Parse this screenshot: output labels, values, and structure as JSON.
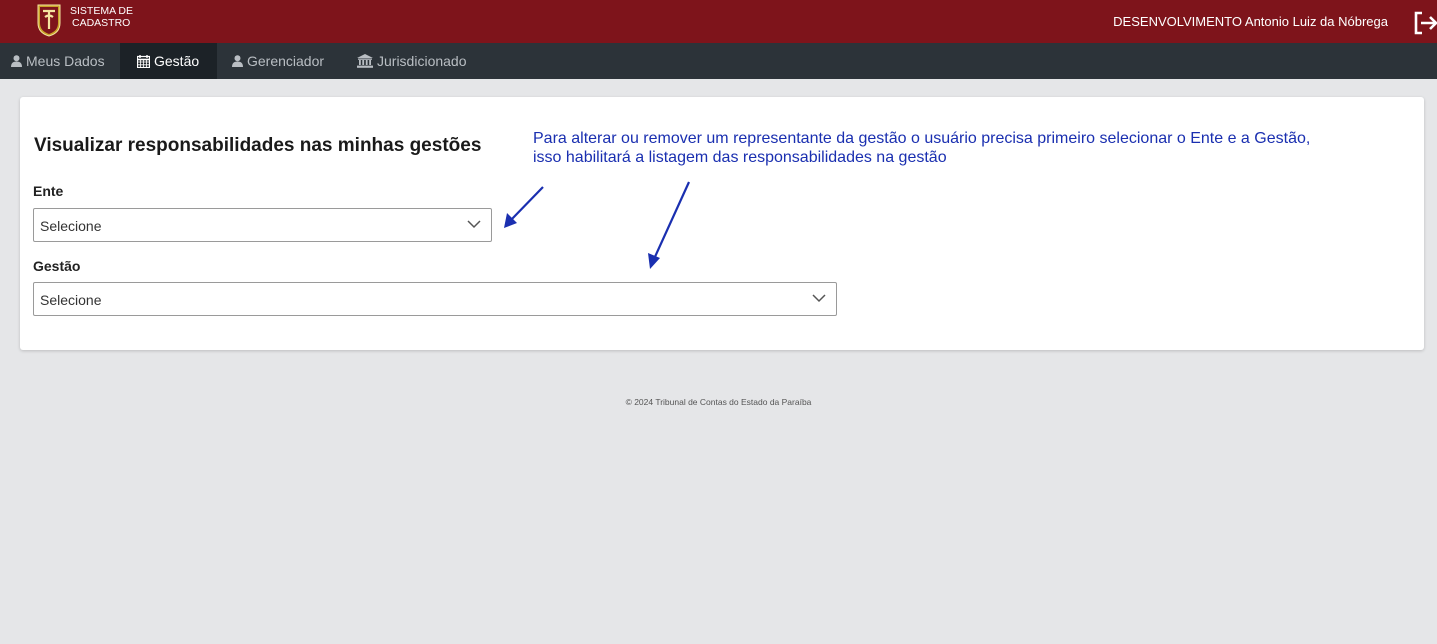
{
  "header": {
    "app_title_line1": "SISTEMA DE",
    "app_title_line2": "CADASTRO",
    "user": "DESENVOLVIMENTO Antonio Luiz da Nóbrega",
    "brand_color": "#7e141b"
  },
  "nav": {
    "items": [
      {
        "label": "Meus Dados",
        "icon": "user-icon"
      },
      {
        "label": "Gestão",
        "icon": "calendar-icon"
      },
      {
        "label": "Gerenciador",
        "icon": "user-icon"
      },
      {
        "label": "Jurisdicionado",
        "icon": "bank-icon"
      }
    ],
    "active": "Gestão"
  },
  "main": {
    "title": "Visualizar responsabilidades nas minhas gestões",
    "ente_label": "Ente",
    "ente_value": "Selecione",
    "gestao_label": "Gestão",
    "gestao_value": "Selecione",
    "hint_line1": "Para alterar ou remover um representante da gestão o usuário precisa primeiro selecionar o Ente e a Gestão,",
    "hint_line2": "isso habilitará a listagem das responsabilidades na gestão"
  },
  "footer": {
    "text": "© 2024 Tribunal de Contas do Estado da Paraíba"
  }
}
